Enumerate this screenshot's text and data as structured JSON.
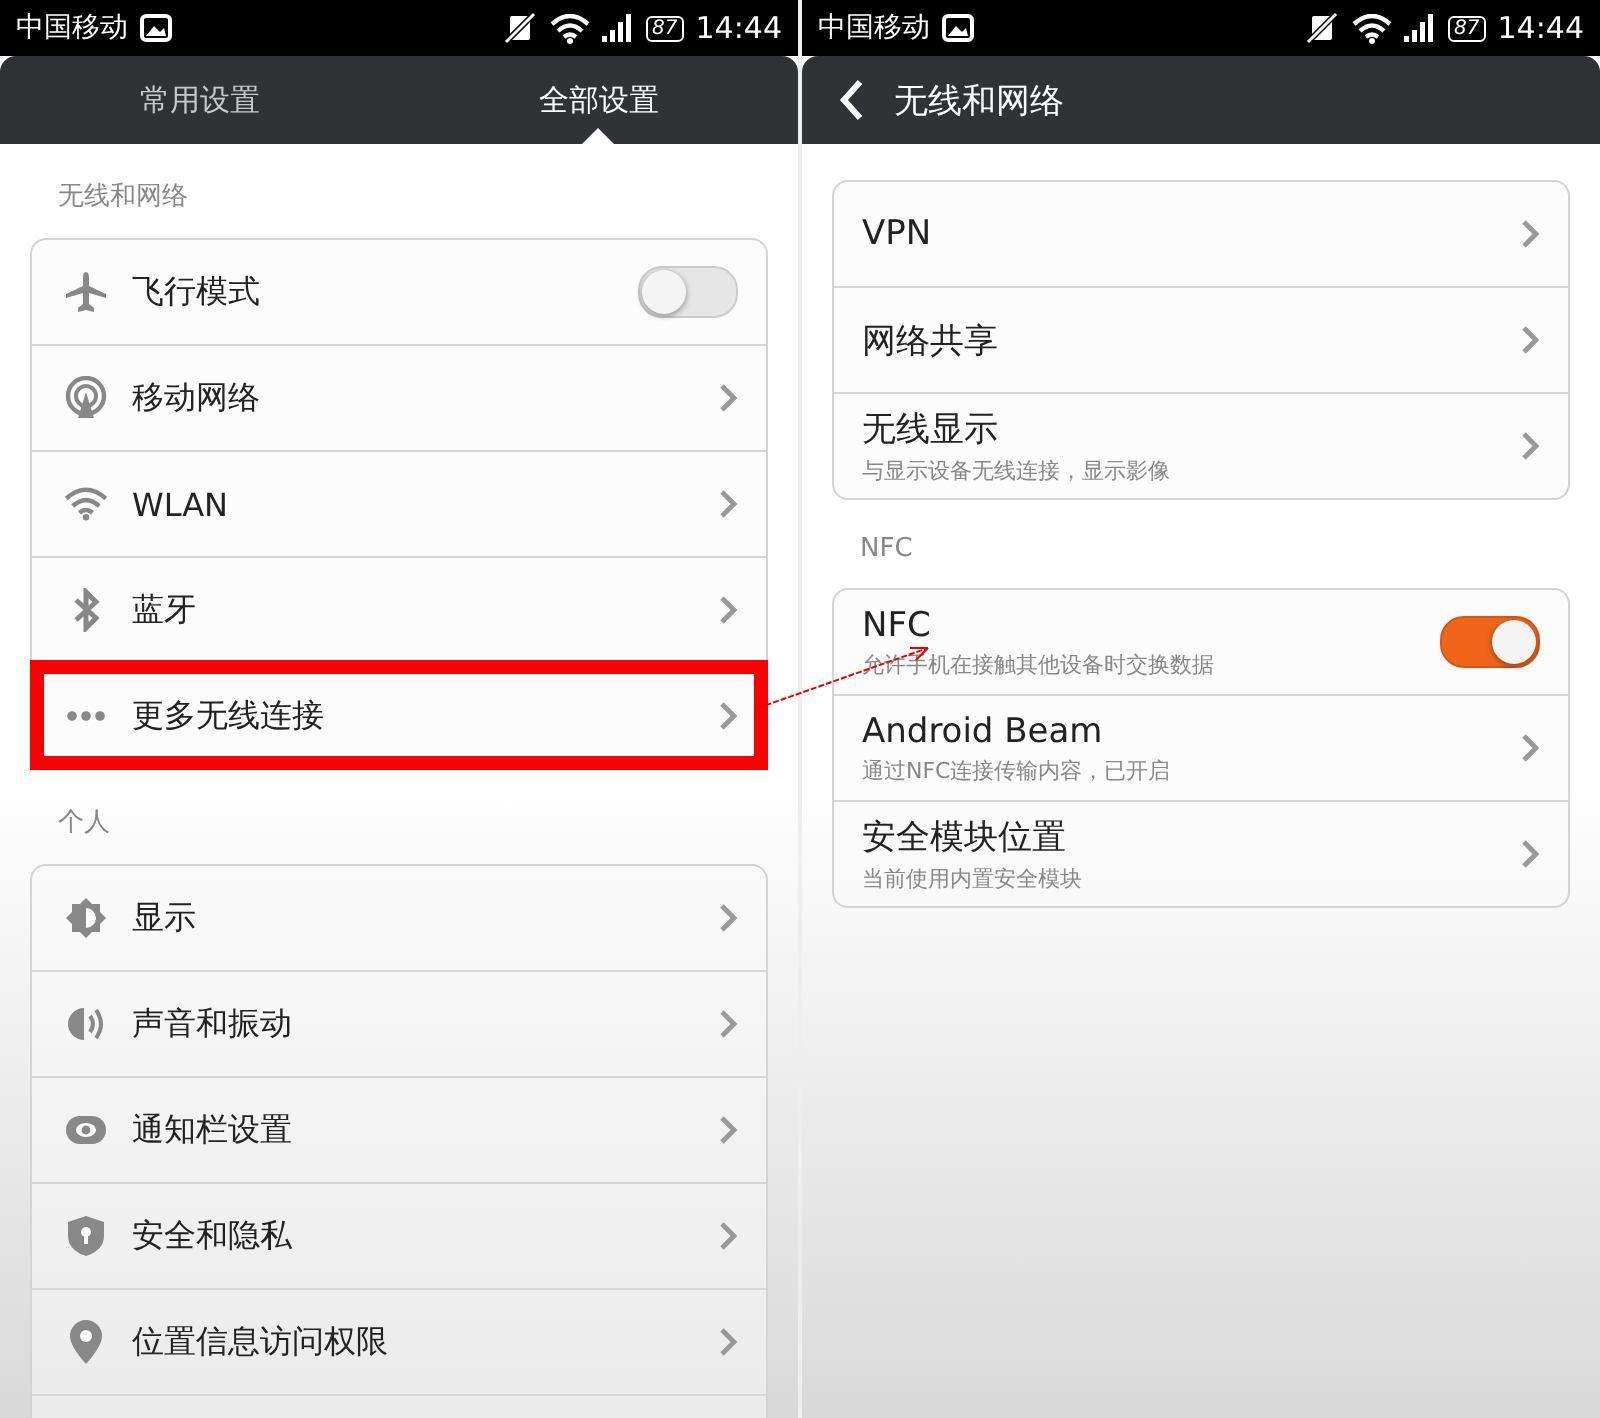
{
  "left": {
    "status_bar": {
      "carrier": "中国移动",
      "battery": "87",
      "time": "14:44"
    },
    "tabs": [
      {
        "label": "常用设置",
        "selected": false
      },
      {
        "label": "全部设置",
        "selected": true
      }
    ],
    "sections": [
      {
        "title": "无线和网络",
        "items": [
          {
            "kind": "toggle",
            "label": "飞行模式",
            "on": false,
            "highlighted": false
          },
          {
            "kind": "link",
            "label": "移动网络",
            "highlighted": false
          },
          {
            "kind": "link",
            "label": "WLAN",
            "highlighted": false
          },
          {
            "kind": "link",
            "label": "蓝牙",
            "highlighted": false
          },
          {
            "kind": "link",
            "label": "更多无线连接",
            "highlighted": true
          }
        ]
      },
      {
        "title": "个人",
        "items": [
          {
            "kind": "link",
            "label": "显示",
            "highlighted": false
          },
          {
            "kind": "link",
            "label": "声音和振动",
            "highlighted": false
          },
          {
            "kind": "link",
            "label": "通知栏设置",
            "highlighted": false
          },
          {
            "kind": "link",
            "label": "安全和隐私",
            "highlighted": false
          },
          {
            "kind": "link",
            "label": "位置信息访问权限",
            "highlighted": false
          }
        ]
      }
    ]
  },
  "right": {
    "status_bar": {
      "carrier": "中国移动",
      "battery": "87",
      "time": "14:44"
    },
    "header": {
      "title": "无线和网络"
    },
    "sections": [
      {
        "items": [
          {
            "kind": "link",
            "label": "VPN"
          },
          {
            "kind": "link",
            "label": "网络共享"
          },
          {
            "kind": "link",
            "label": "无线显示",
            "subtitle": "与显示设备无线连接，显示影像"
          }
        ]
      },
      {
        "title": "NFC",
        "items": [
          {
            "kind": "toggle",
            "label": "NFC",
            "subtitle": "允许手机在接触其他设备时交换数据",
            "on": true
          },
          {
            "kind": "link",
            "label": "Android Beam",
            "subtitle": "通过NFC连接传输内容，已开启"
          },
          {
            "kind": "link",
            "label": "安全模块位置",
            "subtitle": "当前使用内置安全模块"
          }
        ]
      }
    ]
  }
}
